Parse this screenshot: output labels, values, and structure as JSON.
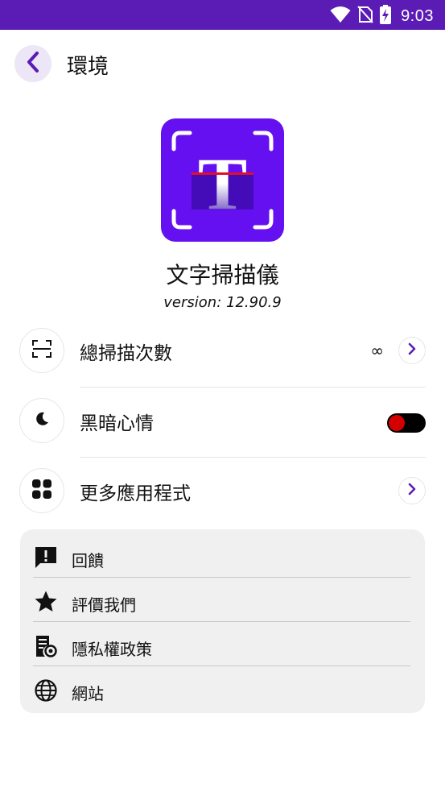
{
  "status_bar": {
    "time": "9:03",
    "icons": [
      "wifi-icon",
      "no-sim-icon",
      "battery-charging-icon"
    ]
  },
  "header": {
    "back_icon": "chevron-left-icon",
    "title": "環境"
  },
  "app": {
    "logo_letter": "T",
    "name": "文字掃描儀",
    "version": "version: 12.90.9"
  },
  "settings": {
    "total_scans": {
      "icon": "scan-frame-icon",
      "label": "總掃描次數",
      "value": "∞"
    },
    "dark_mode": {
      "icon": "moon-icon",
      "label": "黑暗心情",
      "enabled": false
    },
    "more_apps": {
      "icon": "grid-icon",
      "label": "更多應用程式"
    }
  },
  "card": {
    "items": [
      {
        "icon": "feedback-icon",
        "label": "回饋"
      },
      {
        "icon": "star-icon",
        "label": "評價我們"
      },
      {
        "icon": "privacy-policy-icon",
        "label": "隱私權政策"
      },
      {
        "icon": "globe-icon",
        "label": "網站"
      }
    ]
  },
  "colors": {
    "status_bar": "#5b1bb5",
    "accent": "#5b1bb5",
    "logo_bg": "#6410f0",
    "toggle_knob": "#d40000",
    "card_bg": "#f0f0f0"
  }
}
